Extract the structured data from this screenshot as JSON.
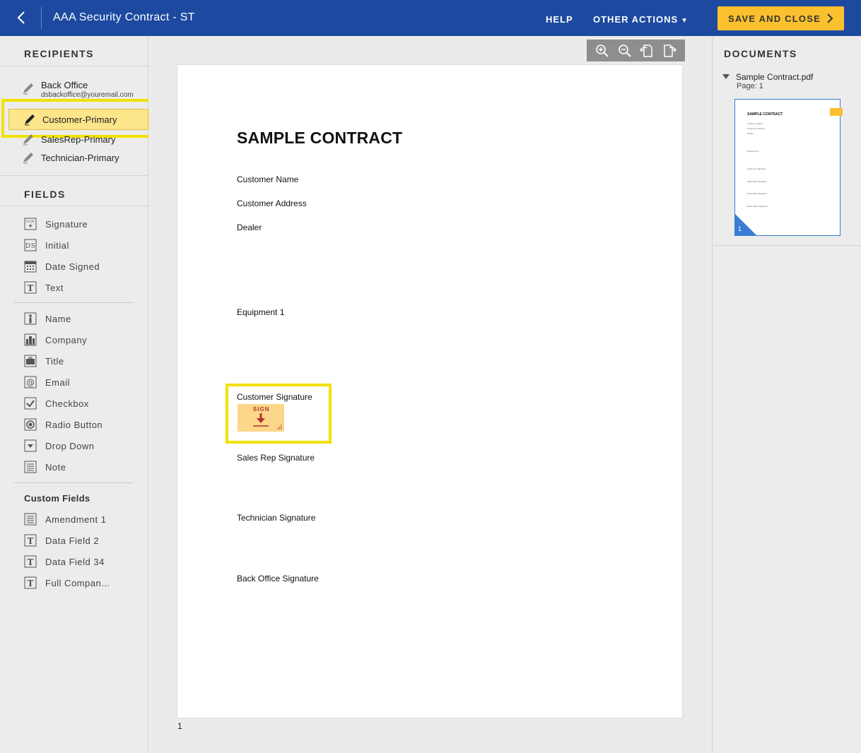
{
  "topbar": {
    "title": "AAA Security Contract - ST",
    "help": "HELP",
    "other_actions": "OTHER ACTIONS",
    "save_close": "SAVE AND CLOSE",
    "bg": "#1d4aa0",
    "accent": "#fbc02d"
  },
  "recipients": {
    "title": "RECIPIENTS",
    "items": [
      {
        "name": "Back Office",
        "email": "dsbackoffice@youremail.com"
      },
      {
        "name": "Customer-Primary",
        "selected": true
      },
      {
        "name": "SalesRep-Primary"
      },
      {
        "name": "Technician-Primary"
      }
    ]
  },
  "fields": {
    "title": "FIELDS",
    "standard": [
      "Signature",
      "Initial",
      "Date Signed",
      "Text"
    ],
    "info": [
      "Name",
      "Company",
      "Title",
      "Email",
      "Checkbox",
      "Radio Button",
      "Drop Down",
      "Note"
    ],
    "custom_title": "Custom Fields",
    "custom": [
      "Amendment 1",
      "Data Field 2",
      "Data Field 34",
      "Full Compan..."
    ]
  },
  "document": {
    "heading": "SAMPLE CONTRACT",
    "lines": [
      "Customer Name",
      "Customer Address",
      "Dealer",
      "Equipment 1",
      "Customer Signature",
      "Sales Rep Signature",
      "Technician Signature",
      "Back Office Signature"
    ],
    "sign_tab_label": "SIGN",
    "page_number": "1"
  },
  "documents_panel": {
    "title": "DOCUMENTS",
    "file": "Sample Contract.pdf",
    "page_label": "Page: 1",
    "thumb_page": "1"
  },
  "highlight_color": "#f2e100"
}
